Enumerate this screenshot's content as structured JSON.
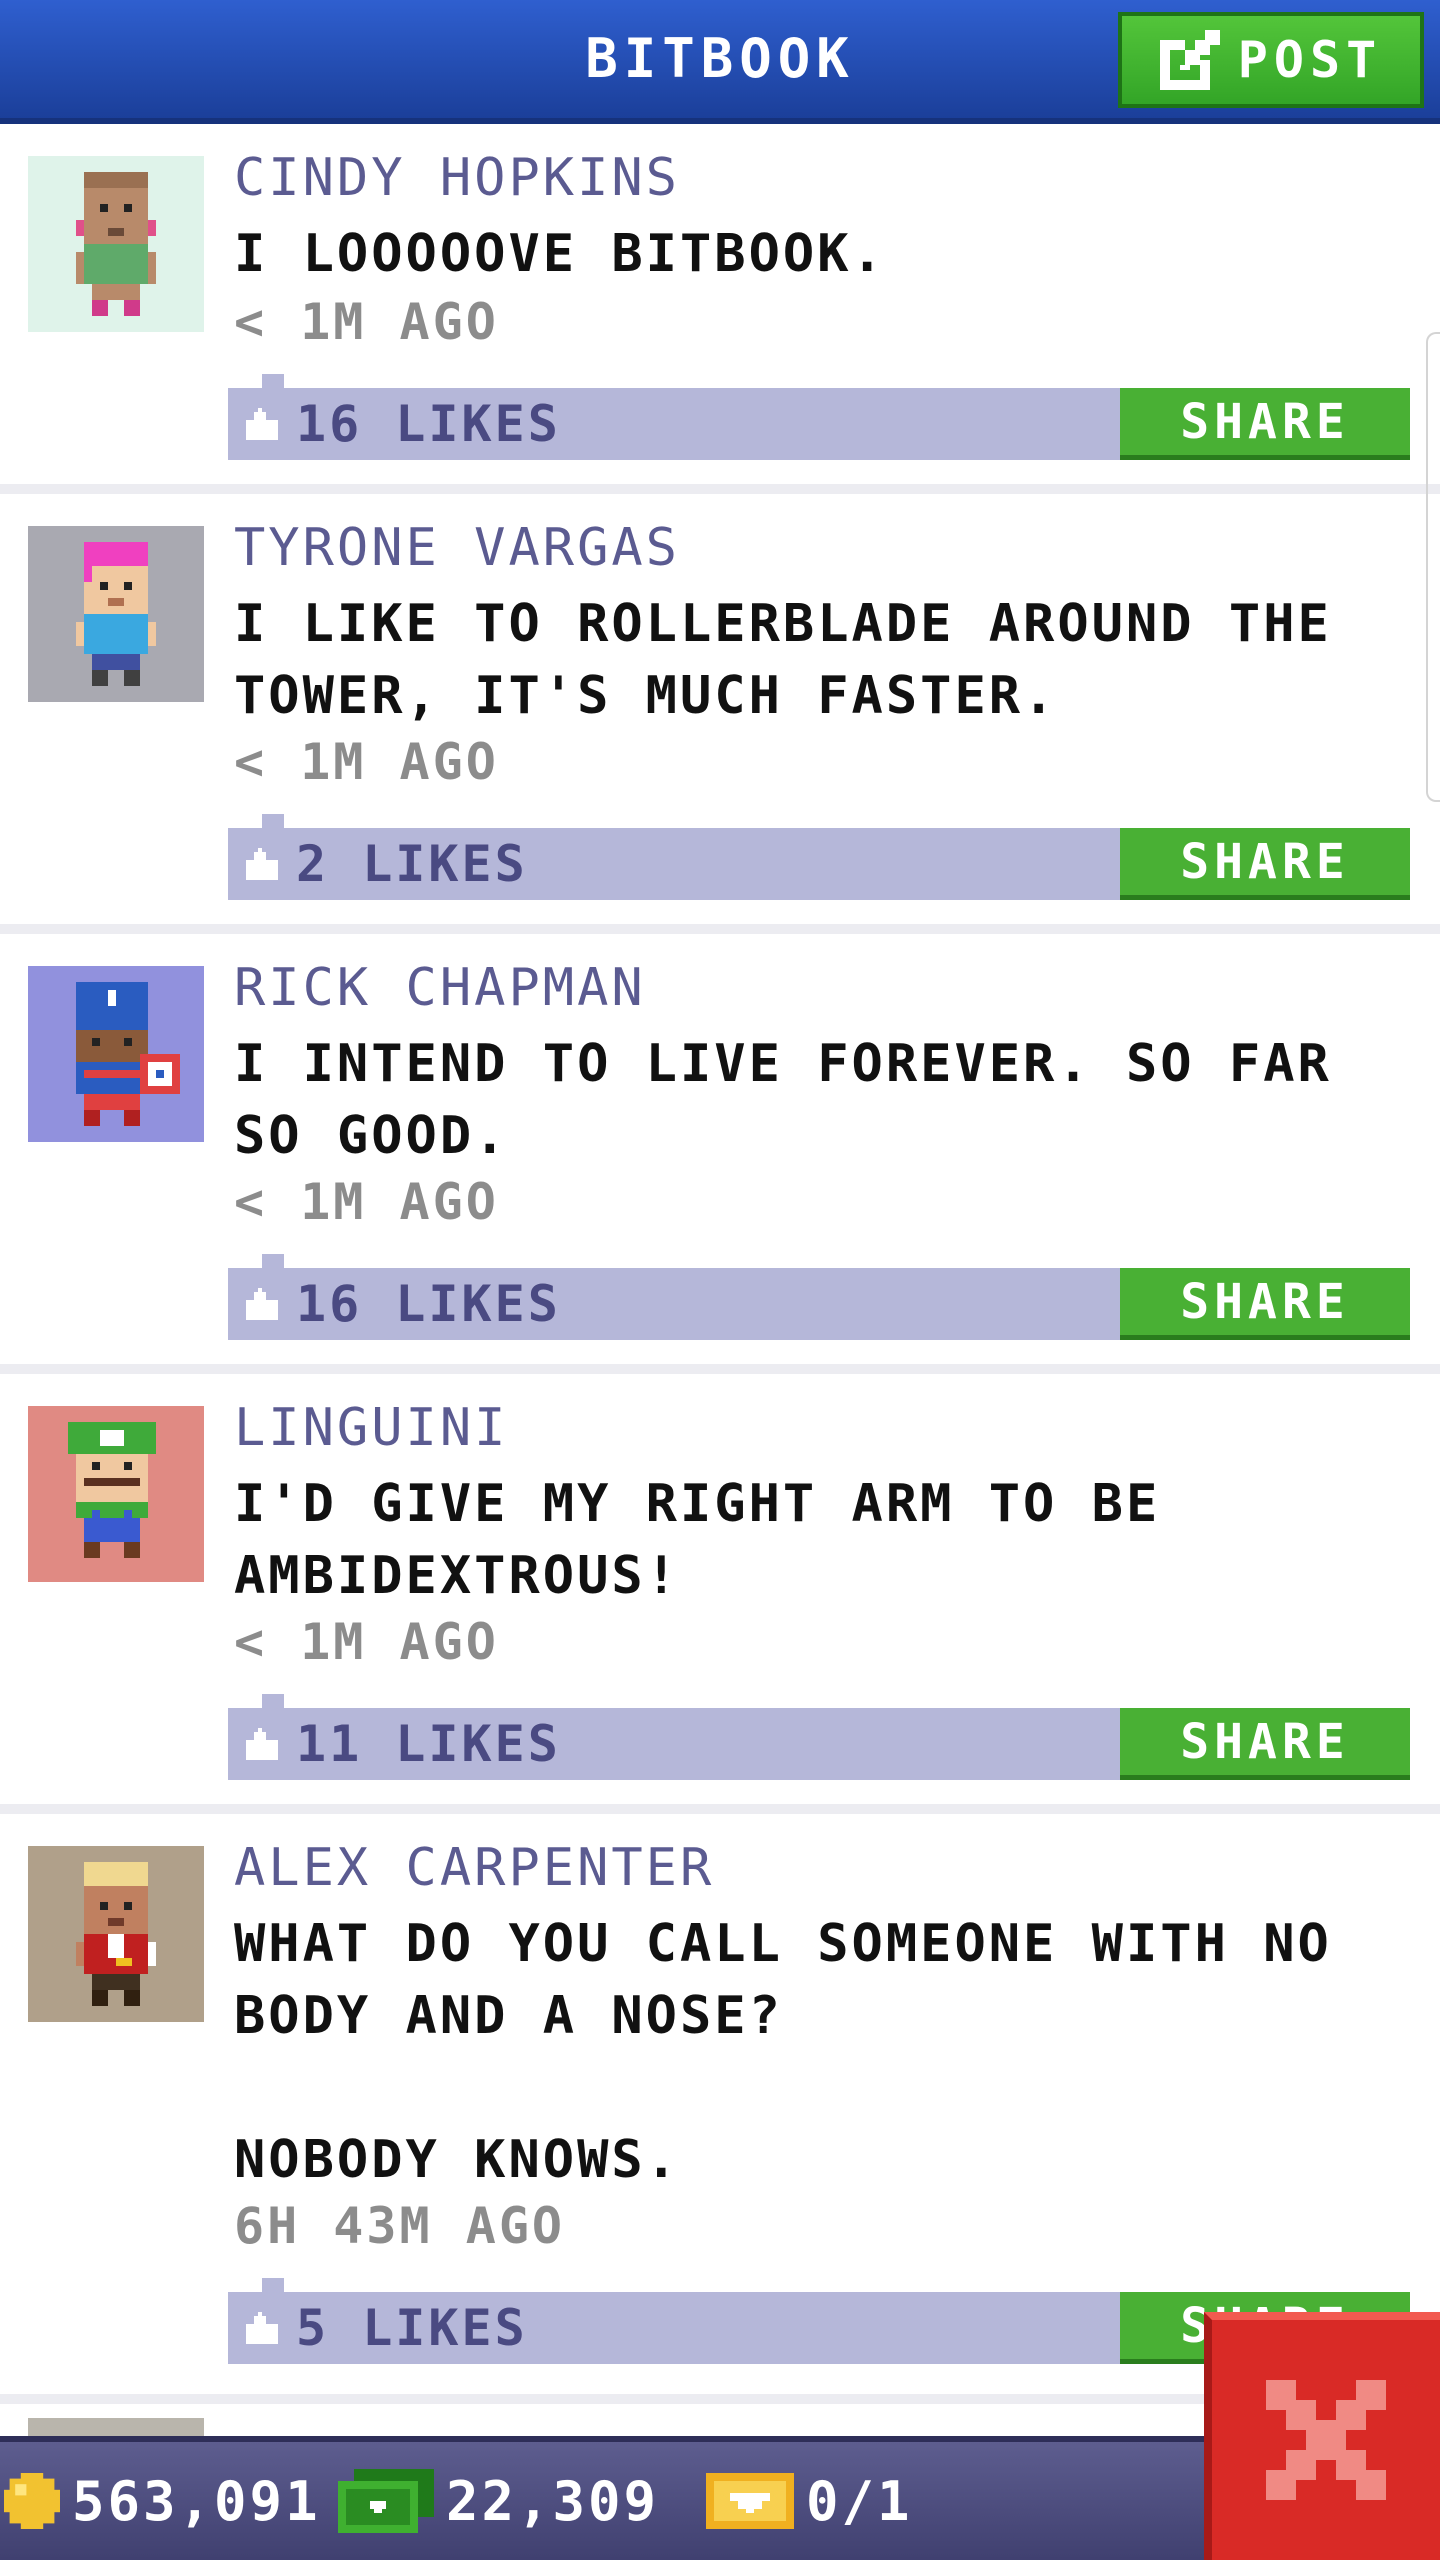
{
  "header": {
    "title": "BITBOOK",
    "post_label": "POST"
  },
  "posts": [
    {
      "author": "CINDY HOPKINS",
      "text": "I LOOOOOVE BITBOOK.",
      "time": "< 1M AGO",
      "likes": "16 LIKES",
      "share_label": "SHARE",
      "avatar_bg": "#dff3ea",
      "avatar_icon": "cindy-avatar-icon"
    },
    {
      "author": "TYRONE VARGAS",
      "text": "I LIKE TO ROLLERBLADE AROUND THE TOWER, IT'S MUCH FASTER.",
      "time": "< 1M AGO",
      "likes": "2 LIKES",
      "share_label": "SHARE",
      "avatar_bg": "#a9a9b1",
      "avatar_icon": "tyrone-avatar-icon"
    },
    {
      "author": "RICK CHAPMAN",
      "text": "I INTEND TO LIVE FOREVER. SO FAR SO GOOD.",
      "time": "< 1M AGO",
      "likes": "16 LIKES",
      "share_label": "SHARE",
      "avatar_bg": "#9191dd",
      "avatar_icon": "rick-avatar-icon"
    },
    {
      "author": "LINGUINI",
      "text": "I'D GIVE MY RIGHT ARM TO BE AMBIDEXTROUS!",
      "time": "< 1M AGO",
      "likes": "11 LIKES",
      "share_label": "SHARE",
      "avatar_bg": "#e08a83",
      "avatar_icon": "linguini-avatar-icon"
    },
    {
      "author": "ALEX CARPENTER",
      "text": "WHAT DO YOU CALL SOMEONE WITH NO BODY AND A NOSE?\n\nNOBODY KNOWS.",
      "time": "6H 43M AGO",
      "likes": "5 LIKES",
      "share_label": "SHARE",
      "avatar_bg": "#b0a08a",
      "avatar_icon": "alex-avatar-icon"
    }
  ],
  "bottom_bar": {
    "coins": "563,091",
    "bux": "22,309",
    "tickets": "0/1"
  },
  "colors": {
    "header": "#2f5fcf",
    "accent_green": "#49b034",
    "likes_bar": "#b5b7d9",
    "close_red": "#d92a26"
  }
}
